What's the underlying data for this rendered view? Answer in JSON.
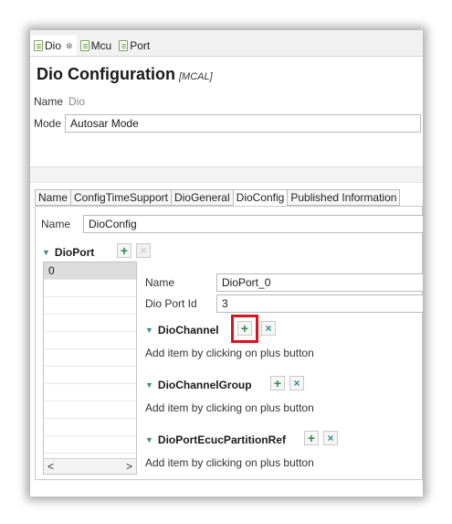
{
  "editor_tabs": [
    {
      "label": "Dio",
      "close": "⊗",
      "active": true
    },
    {
      "label": "Mcu",
      "active": false
    },
    {
      "label": "Port",
      "active": false
    }
  ],
  "header": {
    "title": "Dio Configuration",
    "subtitle": "[MCAL]"
  },
  "module_fields": {
    "name_label": "Name",
    "name_value": "Dio",
    "mode_label": "Mode",
    "mode_value": "Autosar Mode"
  },
  "subtabs": [
    "Name",
    "ConfigTimeSupport",
    "DioGeneral",
    "DioConfig",
    "Published Information"
  ],
  "active_subtab": "DioConfig",
  "dioconfig": {
    "name_label": "Name",
    "name_value": "DioConfig"
  },
  "dioport": {
    "title": "DioPort",
    "add": "+",
    "remove": "×",
    "list": [
      "0"
    ],
    "scroll_left": "<",
    "scroll_right": ">"
  },
  "port_details": {
    "name_label": "Name",
    "name_value": "DioPort_0",
    "id_label": "Dio Port Id",
    "id_value": "3"
  },
  "sections": [
    {
      "title": "DioChannel",
      "hint": "Add item by clicking on plus button",
      "add": "+",
      "remove": "×"
    },
    {
      "title": "DioChannelGroup",
      "hint": "Add item by clicking on plus button",
      "add": "+",
      "remove": "×"
    },
    {
      "title": "DioPortEcucPartitionRef",
      "hint": "Add item by clicking on plus button",
      "add": "+",
      "remove": "×"
    }
  ],
  "colors": {
    "highlight": "#d9141c",
    "add_icon": "#2f8b4a",
    "accent": "#3a8a8a"
  }
}
